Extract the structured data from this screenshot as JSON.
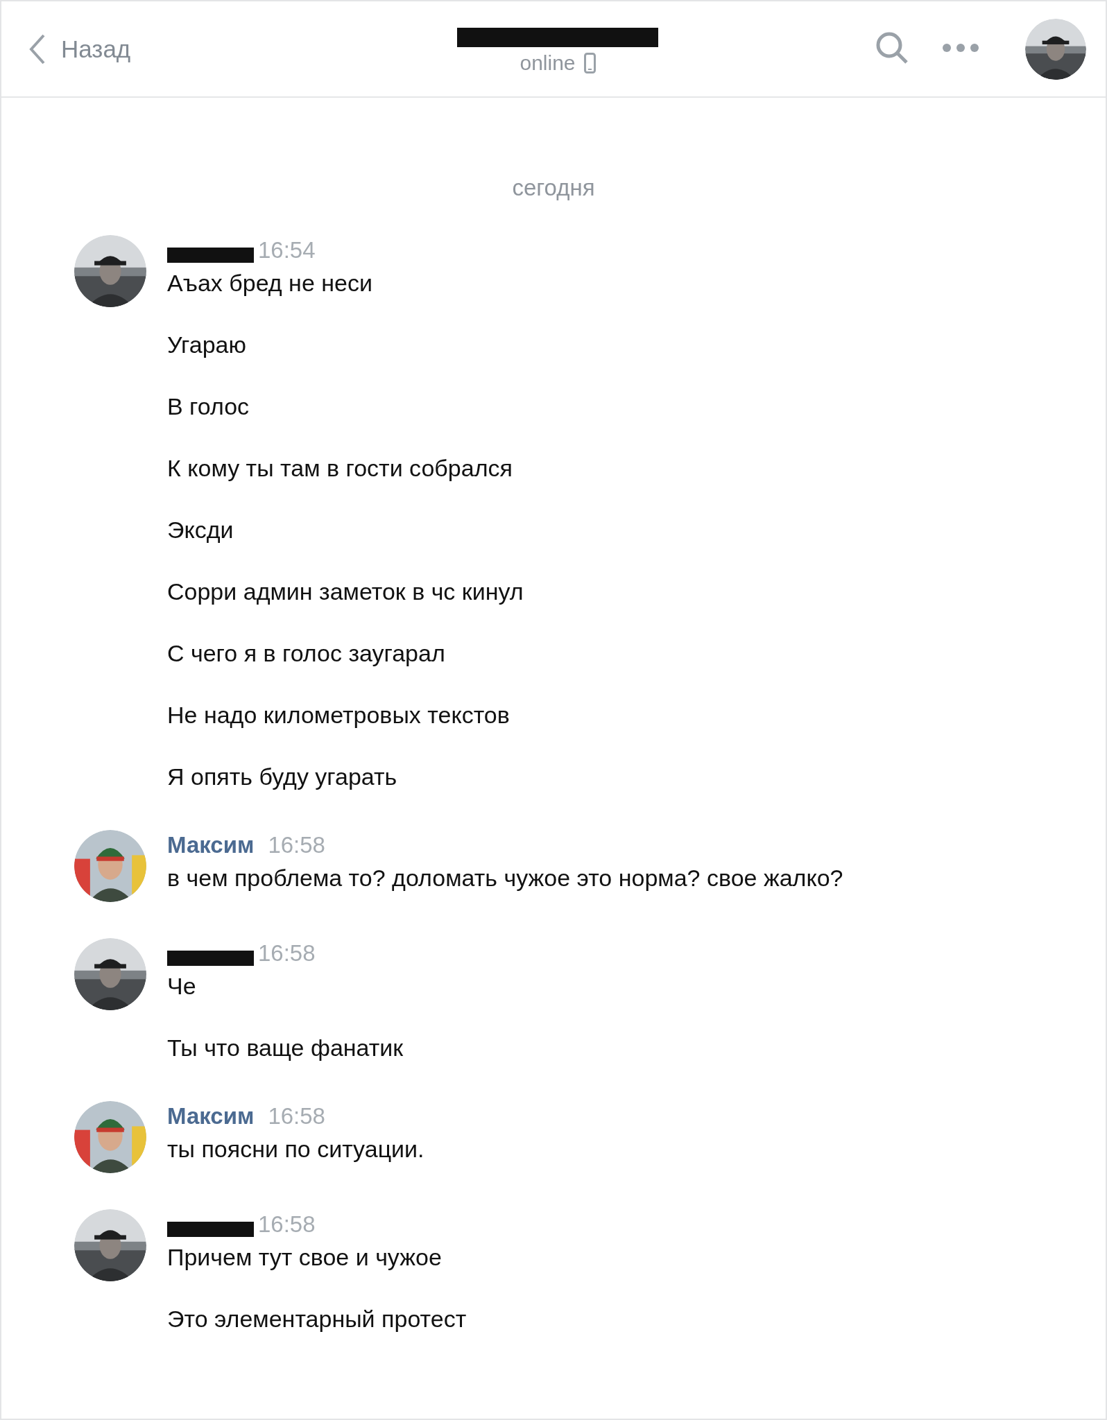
{
  "header": {
    "back_label": "Назад",
    "status": "online"
  },
  "date_divider": "сегодня",
  "messages": [
    {
      "kind": "redacted",
      "time": "16:54",
      "lines": [
        "Аъах бред не неси",
        "Угараю",
        "В голос",
        "К кому ты там в гости собрался",
        "Эксди",
        "Сорри админ заметок в чс кинул",
        "С чего я в голос заугарал",
        "Не надо километровых текстов",
        "Я опять буду угарать"
      ]
    },
    {
      "kind": "named",
      "author": "Максим",
      "time": "16:58",
      "lines": [
        "в чем проблема то? доломать чужое это норма? свое жалко?"
      ]
    },
    {
      "kind": "redacted",
      "time": "16:58",
      "lines": [
        "Че",
        "Ты что ваще фанатик"
      ]
    },
    {
      "kind": "named",
      "author": "Максим",
      "time": "16:58",
      "lines": [
        "ты поясни по ситуации."
      ]
    },
    {
      "kind": "redacted",
      "time": "16:58",
      "lines": [
        "Причем тут свое и чужое",
        "Это элементарный протест"
      ]
    }
  ]
}
